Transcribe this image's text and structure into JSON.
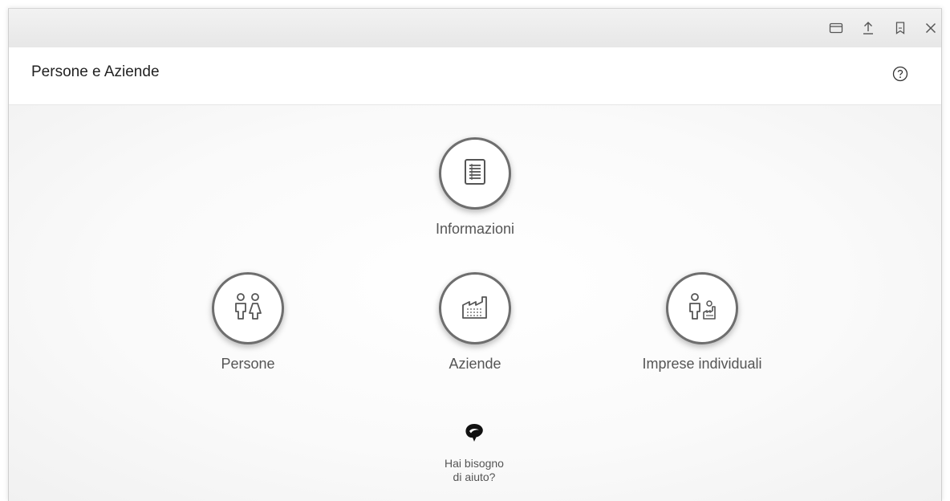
{
  "window": {
    "controls": [
      {
        "icon": "window-icon",
        "label": ""
      },
      {
        "icon": "upload-icon",
        "label": ""
      },
      {
        "icon": "bookmark-icon",
        "label": ""
      },
      {
        "icon": "close-icon",
        "label": ""
      }
    ]
  },
  "header": {
    "title": "Persone e Aziende",
    "help_icon": "help-circle-icon"
  },
  "tiles": [
    {
      "label": "Informazioni",
      "icon": "document-list-icon"
    },
    {
      "label": "Persone",
      "icon": "people-icon"
    },
    {
      "label": "Aziende",
      "icon": "factory-icon"
    },
    {
      "label": "Imprese individuali",
      "icon": "person-business-icon"
    }
  ],
  "help": {
    "line1": "Hai bisogno",
    "line2": "di aiuto?",
    "icon": "assistant-logo-icon"
  },
  "colors": {
    "icon_stroke": "#555555",
    "circle_border": "#6e6e6e",
    "title_text": "#222222",
    "label_text": "#555555"
  }
}
